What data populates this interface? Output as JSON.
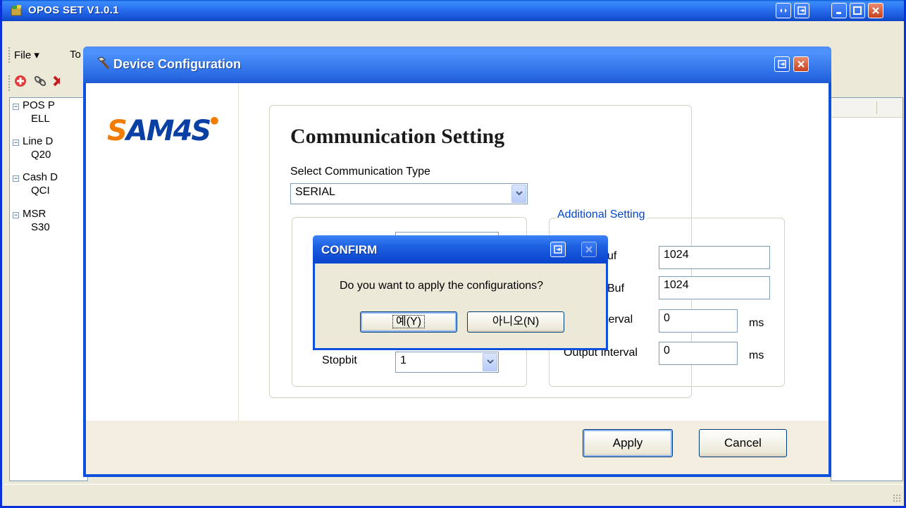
{
  "main_window": {
    "title": "OPOS SET V1.0.1",
    "menu": [
      {
        "label": "File ▾"
      },
      {
        "label": "To"
      }
    ],
    "tree": [
      {
        "label": "POS P",
        "level": 0
      },
      {
        "label": "ELL",
        "level": 1
      },
      {
        "label": "Line D",
        "level": 0
      },
      {
        "label": "Q20",
        "level": 1
      },
      {
        "label": "Cash D",
        "level": 0
      },
      {
        "label": "QCI",
        "level": 1
      },
      {
        "label": "MSR",
        "level": 0
      },
      {
        "label": "S30",
        "level": 1
      }
    ]
  },
  "device_config": {
    "title": "Device Configuration",
    "logo": "SAM4S",
    "heading": "Communication Setting",
    "select_label": "Select Communication Type",
    "comm_type": "SERIAL",
    "stopbit_label": "Stopbit",
    "stopbit_value": "1",
    "additional": {
      "group_label": "Additional Setting",
      "fields": [
        {
          "label": "uf",
          "value": "1024",
          "unit": ""
        },
        {
          "label": "Buf",
          "value": "1024",
          "unit": ""
        },
        {
          "label": "terval",
          "value": "0",
          "unit": "ms"
        },
        {
          "label": "Output Interval",
          "value": "0",
          "unit": "ms"
        }
      ]
    },
    "apply_label": "Apply",
    "cancel_label": "Cancel"
  },
  "confirm": {
    "title": "CONFIRM",
    "message": "Do you want to apply the configurations?",
    "yes_label": "예(Y)",
    "no_label": "아니오(N)"
  },
  "colors": {
    "titlebar_blue": "#2666e0",
    "dialog_bg": "#ece9d8",
    "group_label": "#0046d5",
    "logo_blue": "#0a3fa3",
    "logo_orange": "#f07c00"
  }
}
